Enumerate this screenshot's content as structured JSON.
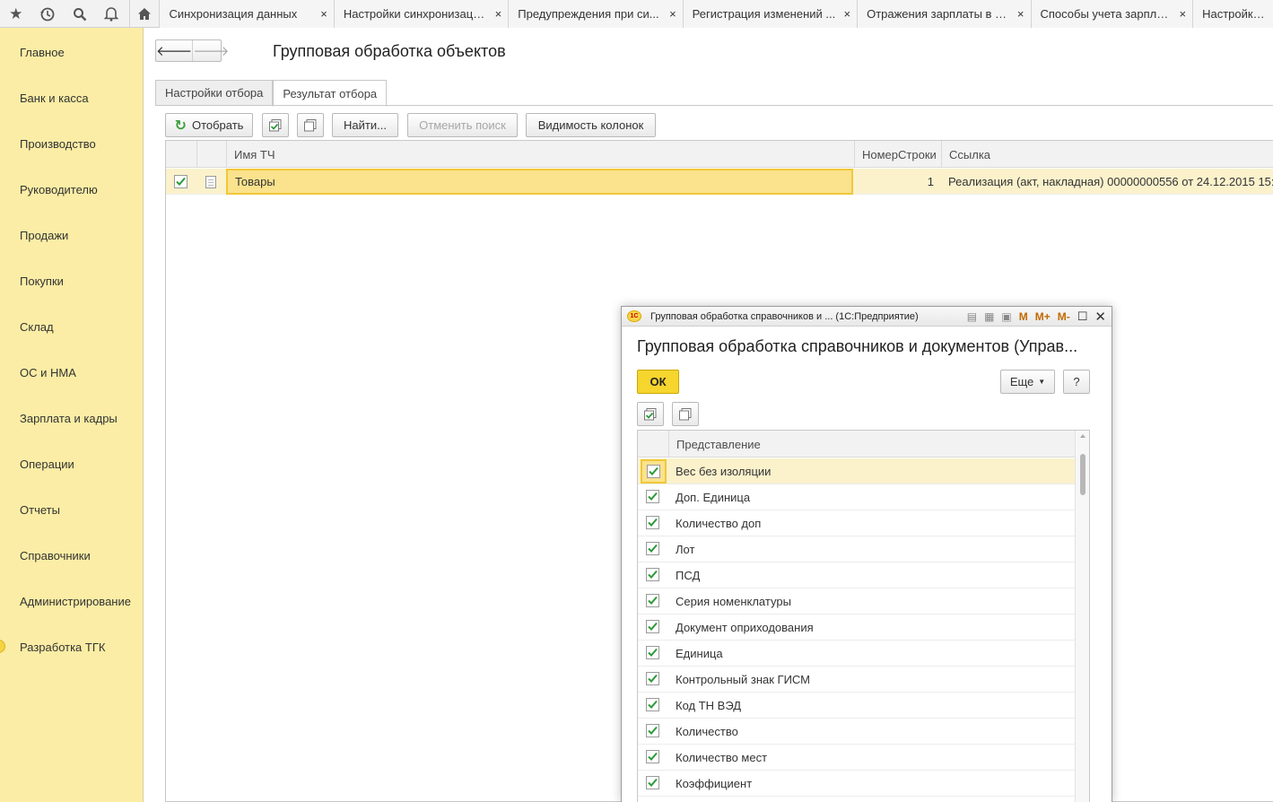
{
  "toolbar_icons": [
    "star-icon",
    "history-icon",
    "search-icon",
    "bell-icon",
    "home-icon"
  ],
  "tabs": [
    {
      "label": "Синхронизация данных",
      "close": "×"
    },
    {
      "label": "Настройки синхронизаци...",
      "close": "×"
    },
    {
      "label": "Предупреждения при си...",
      "close": "×"
    },
    {
      "label": "Регистрация изменений ...",
      "close": "×"
    },
    {
      "label": "Отражения зарплаты в б...",
      "close": "×"
    },
    {
      "label": "Способы учета зарплаты",
      "close": "×"
    },
    {
      "label": "Настройки пол",
      "close": ""
    }
  ],
  "sidebar": {
    "items": [
      {
        "label": "Главное"
      },
      {
        "label": "Банк и касса"
      },
      {
        "label": "Производство"
      },
      {
        "label": "Руководителю"
      },
      {
        "label": "Продажи"
      },
      {
        "label": "Покупки"
      },
      {
        "label": "Склад"
      },
      {
        "label": "ОС и НМА"
      },
      {
        "label": "Зарплата и кадры"
      },
      {
        "label": "Операции"
      },
      {
        "label": "Отчеты"
      },
      {
        "label": "Справочники"
      },
      {
        "label": "Администрирование"
      },
      {
        "label": "Разработка ТГК"
      }
    ]
  },
  "main": {
    "title": "Групповая обработка объектов",
    "form_tabs": [
      "Настройки отбора",
      "Результат отбора"
    ],
    "active_form_tab": "Результат отбора",
    "buttons": {
      "select": "Отобрать",
      "find": "Найти...",
      "cancel_search": "Отменить поиск",
      "column_visibility": "Видимость колонок"
    },
    "table": {
      "columns": [
        "Имя ТЧ",
        "НомерСтроки",
        "Ссылка"
      ],
      "rows": [
        {
          "checked": true,
          "name": "Товары",
          "line_number": "1",
          "link": "Реализация (акт, накладная) 00000000556 от 24.12.2015 15:1"
        }
      ]
    }
  },
  "dialog": {
    "window_title": "Групповая обработка справочников и ... (1С:Предприятие)",
    "window_tools": [
      "М",
      "М+",
      "М-"
    ],
    "heading": "Групповая обработка справочников и документов (Управ...",
    "ok_label": "ОК",
    "more_label": "Еще",
    "help_label": "?",
    "column_header": "Представление",
    "items": [
      {
        "label": "Вес без изоляции",
        "checked": true
      },
      {
        "label": "Доп. Единица",
        "checked": true
      },
      {
        "label": "Количество доп",
        "checked": true
      },
      {
        "label": "Лот",
        "checked": true
      },
      {
        "label": "ПСД",
        "checked": true
      },
      {
        "label": "Серия номенклатуры",
        "checked": true
      },
      {
        "label": "Документ оприходования",
        "checked": true
      },
      {
        "label": "Единица",
        "checked": true
      },
      {
        "label": "Контрольный знак ГИСМ",
        "checked": true
      },
      {
        "label": "Код ТН ВЭД",
        "checked": true
      },
      {
        "label": "Количество",
        "checked": true
      },
      {
        "label": "Количество мест",
        "checked": true
      },
      {
        "label": "Коэффициент",
        "checked": true
      }
    ]
  },
  "colors": {
    "sidebar_bg": "#fbeda5",
    "row_highlight": "#fbf2cc",
    "selected_cell": "#fbe28d",
    "ok_button": "#f6d52d",
    "check_green": "#2c9a3a"
  }
}
